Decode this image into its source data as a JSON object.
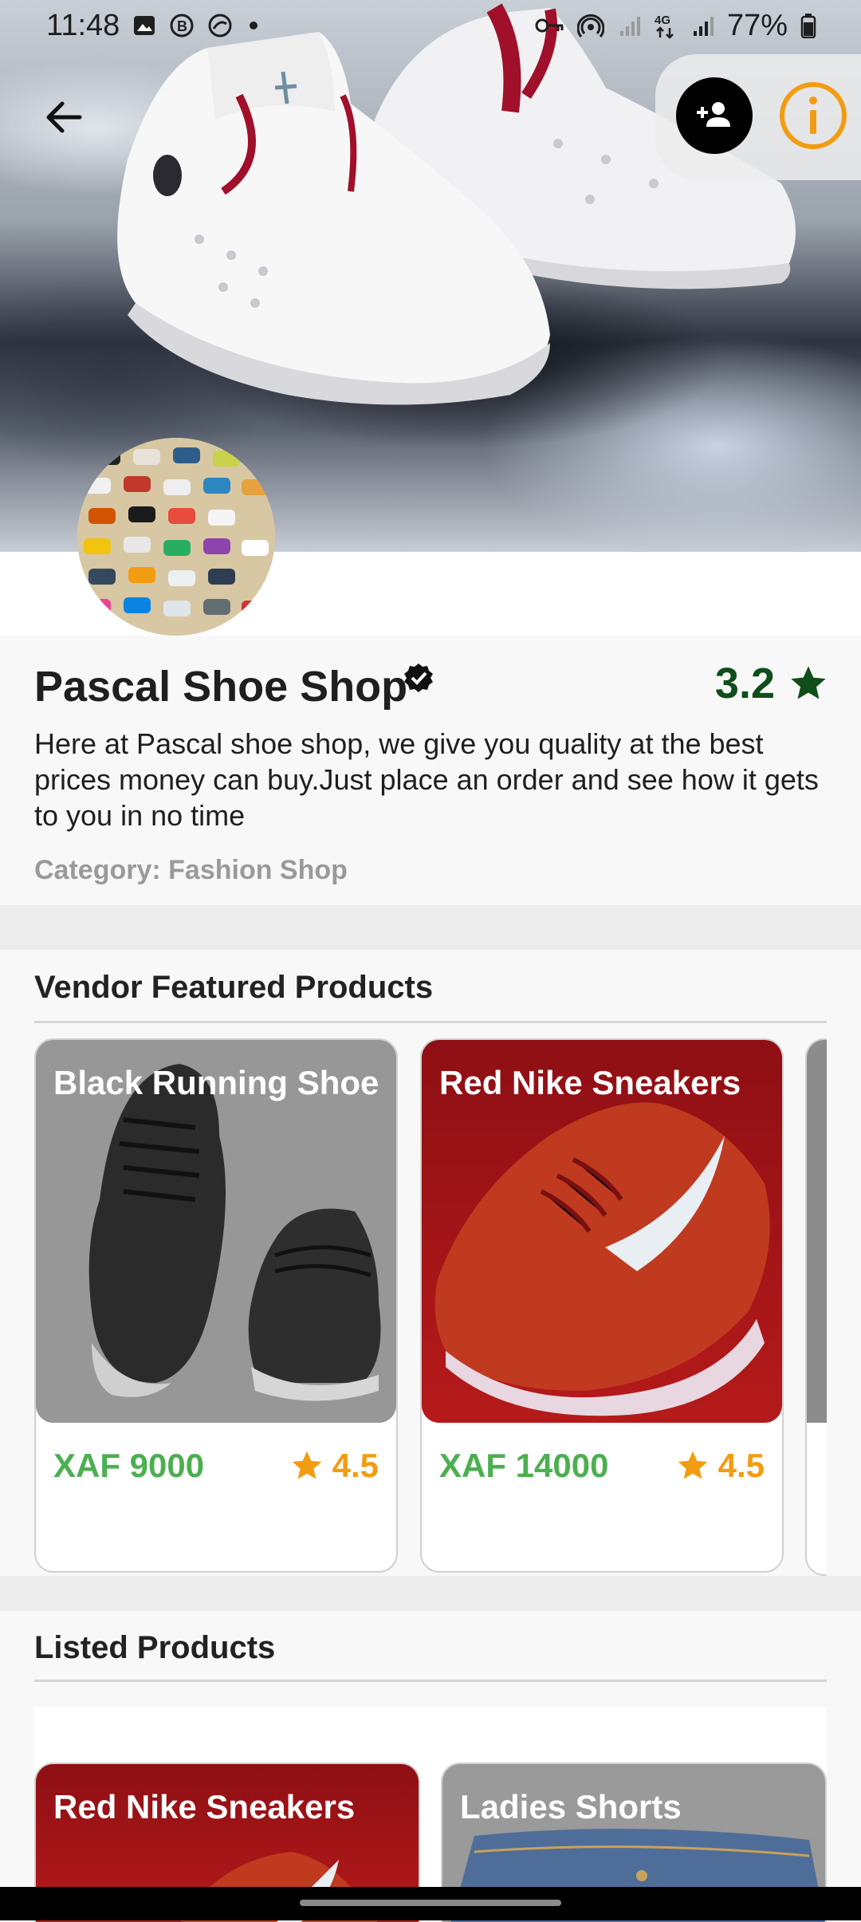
{
  "status_bar": {
    "time": "11:48",
    "battery": "77%",
    "network": "4G",
    "left_icons": [
      "gallery-icon",
      "b-icon",
      "app-icon",
      "dot-icon"
    ],
    "right_icons": [
      "key-icon",
      "hotspot-icon",
      "signal-icon",
      "data-icon",
      "signal-icon",
      "battery-icon"
    ]
  },
  "header": {
    "back_icon": "arrow-left-icon",
    "follow_icon": "person-add-icon",
    "info_icon": "info-icon",
    "follow_color": "#000000",
    "info_color": "#f39c12"
  },
  "shop": {
    "name": "Pascal Shoe Shop",
    "verified": true,
    "rating": "3.2",
    "rating_color": "#0f4d1a",
    "description": "Here at Pascal shoe shop, we give you quality at the best prices money can buy.Just place an order and see how it gets to you in no time",
    "category": "Category: Fashion Shop"
  },
  "featured": {
    "title": "Vendor Featured Products",
    "products": [
      {
        "name": "Black Running Shoe",
        "price": "XAF 9000",
        "rating": "4.5"
      },
      {
        "name": "Red Nike Sneakers",
        "price": "XAF 14000",
        "rating": "4.5"
      }
    ],
    "price_color": "#4caf50",
    "rating_color": "#f39c12"
  },
  "listed": {
    "title": "Listed Products",
    "products": [
      {
        "name": "Red Nike Sneakers"
      },
      {
        "name": "Ladies Shorts"
      }
    ]
  }
}
